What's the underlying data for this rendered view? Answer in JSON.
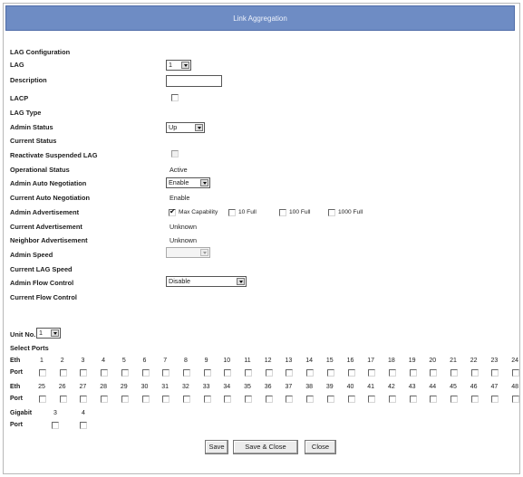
{
  "title": "Link Aggregation",
  "section": "LAG Configuration",
  "fields": [
    {
      "label": "LAG",
      "y": 0
    },
    {
      "label": "Description"
    },
    {
      "label": "LACP"
    },
    {
      "label": "LAG Type"
    },
    {
      "label": "Admin Status"
    },
    {
      "label": "Current Status"
    },
    {
      "label": "Reactivate Suspended LAG"
    },
    {
      "label": "Operational Status"
    },
    {
      "label": "Admin Auto Negotiation"
    },
    {
      "label": "Current Auto Negotiation"
    },
    {
      "label": "Admin Advertisement"
    },
    {
      "label": "Current Advertisement"
    },
    {
      "label": "Neighbor Advertisement"
    },
    {
      "label": "Admin Speed"
    },
    {
      "label": "Current LAG Speed"
    },
    {
      "label": "Admin Flow Control"
    },
    {
      "label": "Current Flow Control"
    }
  ],
  "values": {
    "lag": "1",
    "admin_status": "Up",
    "operational_status": "Active",
    "admin_auto_negotiation": "Enable",
    "current_auto_negotiation": "Enable",
    "current_advertisement": "Unknown",
    "neighbor_advertisement": "Unknown",
    "admin_flow_control": "Disable"
  },
  "advertisement_options": [
    {
      "label": "Max Capability",
      "checked": true
    },
    {
      "label": "10 Full",
      "checked": false
    },
    {
      "label": "100 Full",
      "checked": false
    },
    {
      "label": "1000 Full",
      "checked": false
    }
  ],
  "unit_label": "Unit No.",
  "unit_value": "1",
  "select_ports_label": "Select Ports",
  "eth_label": "Eth",
  "port_label": "Port",
  "gigabit_label": "Gigabit",
  "eth_row1": [
    "1",
    "2",
    "3",
    "4",
    "5",
    "6",
    "7",
    "8",
    "9",
    "10",
    "11",
    "12",
    "13",
    "14",
    "15",
    "16",
    "17",
    "18",
    "19",
    "20",
    "21",
    "22",
    "23",
    "24"
  ],
  "eth_row2": [
    "25",
    "26",
    "27",
    "28",
    "29",
    "30",
    "31",
    "32",
    "33",
    "34",
    "35",
    "36",
    "37",
    "38",
    "39",
    "40",
    "41",
    "42",
    "43",
    "44",
    "45",
    "46",
    "47",
    "48"
  ],
  "gigabit_ports": [
    "3",
    "4"
  ],
  "buttons": {
    "save": "Save",
    "save_close": "Save & Close",
    "close": "Close"
  }
}
